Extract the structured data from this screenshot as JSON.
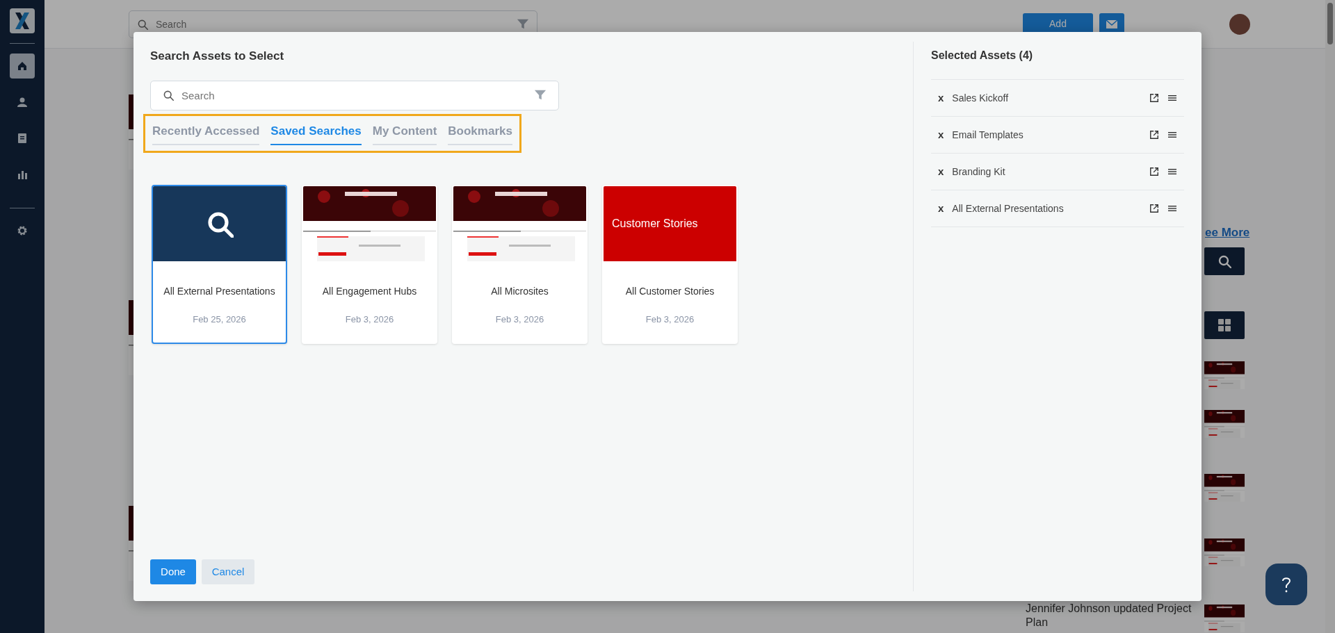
{
  "sidebar": {
    "items": [
      {
        "selected": true
      },
      {
        "selected": false
      },
      {
        "selected": false
      },
      {
        "selected": false
      },
      {
        "selected": false
      }
    ]
  },
  "top_bar": {
    "search": {
      "placeholder": "Search"
    },
    "add_button": "Add"
  },
  "background": {
    "see_more": "ee More",
    "activity": "Jennifer Johnson updated Project Plan"
  },
  "modal": {
    "title": "Search Assets to Select",
    "search": {
      "placeholder": "Search"
    },
    "tabs": [
      {
        "label": "Recently Accessed",
        "selected": false
      },
      {
        "label": "Saved Searches",
        "selected": true
      },
      {
        "label": "My Content",
        "selected": false
      },
      {
        "label": "Bookmarks",
        "selected": false
      }
    ],
    "cards": [
      {
        "kind": "search",
        "title": "All External Presentations",
        "date": "Feb 25, 2026",
        "selected": true
      },
      {
        "kind": "picture",
        "title": "All Engagement Hubs",
        "date": "Feb 3, 2026",
        "selected": false
      },
      {
        "kind": "picture",
        "title": "All Microsites",
        "date": "Feb 3, 2026",
        "selected": false
      },
      {
        "kind": "banner",
        "banner_text": "Customer Stories",
        "title": "All Customer Stories",
        "date": "Feb 3, 2026",
        "selected": false
      }
    ],
    "buttons": {
      "done": "Done",
      "cancel": "Cancel"
    },
    "selected_panel": {
      "title": "Selected Assets (4)",
      "items": [
        {
          "remove": "x",
          "name": "Sales Kickoff"
        },
        {
          "remove": "x",
          "name": "Email Templates"
        },
        {
          "remove": "x",
          "name": "Branding Kit"
        },
        {
          "remove": "x",
          "name": "All External Presentations"
        }
      ]
    }
  }
}
